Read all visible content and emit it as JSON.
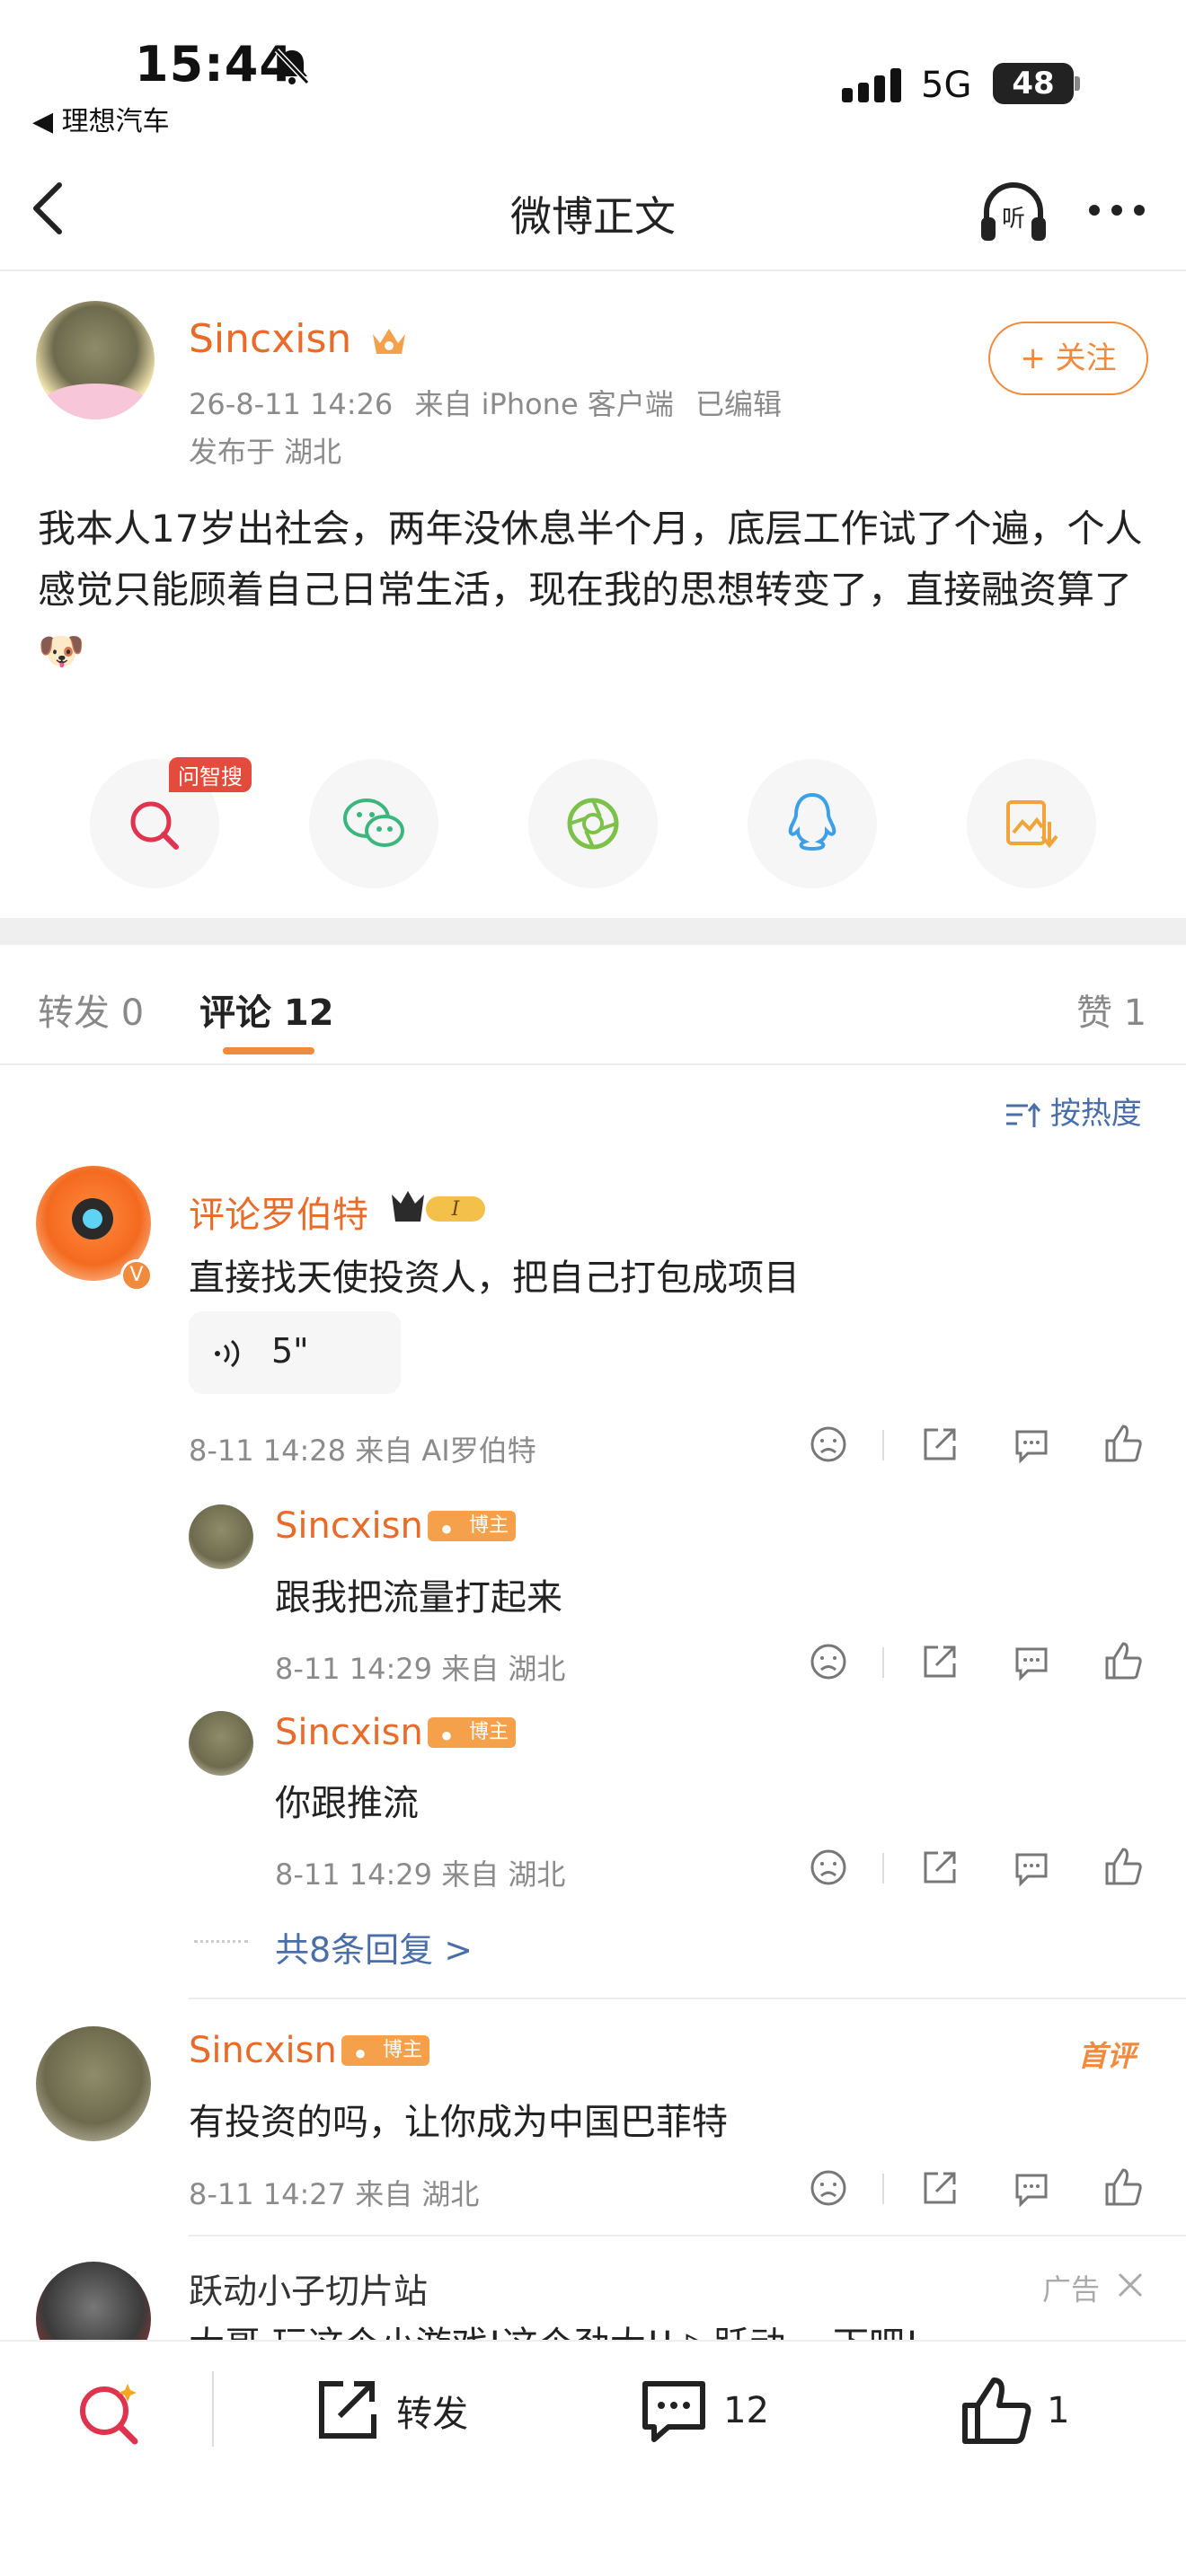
{
  "status_bar": {
    "time": "15:44",
    "back_app": "◀ 理想汽车",
    "network": "5G",
    "battery": "48"
  },
  "nav": {
    "title": "微博正文"
  },
  "post": {
    "author": "Sincxisn",
    "time": "26-8-11 14:26",
    "source": "来自 iPhone 客户端",
    "edited": "已编辑",
    "location": "发布于 湖北",
    "follow_label": "+ 关注",
    "text": "我本人17岁出社会，两年没休息半个月，底层工作试了个遍，个人感觉只能顾着自己日常生活，现在我的思想转变了，直接融资算了🐶",
    "search_badge": "问智搜"
  },
  "tabs": {
    "repost": "转发 0",
    "comment": "评论 12",
    "like": "赞 1"
  },
  "sort_label": "按热度",
  "comments": [
    {
      "name": "评论罗伯特",
      "text": "直接找天使投资人，把自己打包成项目",
      "voice": "5\"",
      "meta": "8-11 14:28  来自 AI罗伯特",
      "replies": [
        {
          "name": "Sincxisn",
          "badge": "博主",
          "text": "跟我把流量打起来",
          "meta": "8-11 14:29  来自 湖北"
        },
        {
          "name": "Sincxisn",
          "badge": "博主",
          "text": "你跟推流",
          "meta": "8-11 14:29  来自 湖北"
        }
      ],
      "more_replies": "共8条回复 >"
    },
    {
      "name": "Sincxisn",
      "badge": "博主",
      "tag": "首评",
      "text": "有投资的吗，让你成为中国巴菲特",
      "meta": "8-11 14:27  来自 湖北"
    }
  ],
  "ad": {
    "name": "跃动小子切片站",
    "label": "广告",
    "text": "大哥 玩这个小游戏!这个劲大!! ▷跃动 一下吧!"
  },
  "bottom_bar": {
    "repost": "转发",
    "comments": "12",
    "likes": "1"
  },
  "colors": {
    "accent": "#e86b2a",
    "follow": "#f08a3c",
    "link": "#4a6ea9"
  }
}
